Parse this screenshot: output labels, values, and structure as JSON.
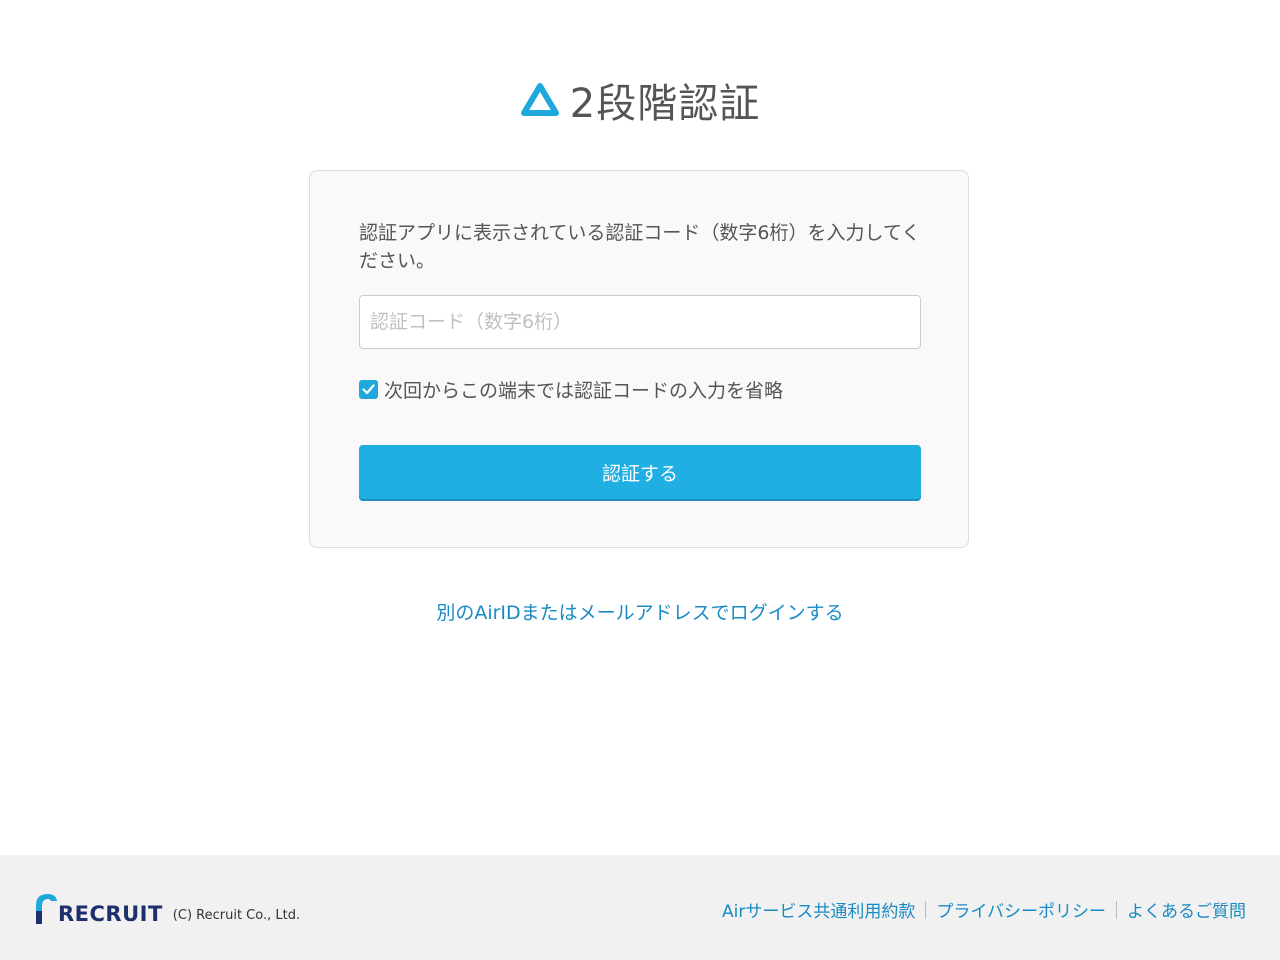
{
  "header": {
    "title": "2段階認証",
    "logo_icon": "air-triangle-icon",
    "accent_color": "#1fa8dc"
  },
  "form": {
    "instruction": "認証アプリに表示されている認証コード（数字6桁）を入力してください。",
    "code_placeholder": "認証コード（数字6桁）",
    "code_value": "",
    "remember_label": "次回からこの端末では認証コードの入力を省略",
    "remember_checked": true,
    "submit_label": "認証する"
  },
  "alt_login": {
    "label": "別のAirIDまたはメールアドレスでログインする"
  },
  "footer": {
    "brand": "RECRUIT",
    "copyright": "(C) Recruit Co., Ltd.",
    "links": [
      {
        "label": "Airサービス共通利用約款"
      },
      {
        "label": "プライバシーポリシー"
      },
      {
        "label": "よくあるご質問"
      }
    ]
  }
}
